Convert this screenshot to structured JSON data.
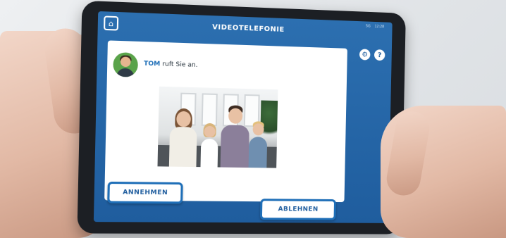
{
  "screen": {
    "title": "VIDEOTELEFONIE",
    "status_left": "5G",
    "status_right": "12:28",
    "accent_color": "#1f5d9e"
  },
  "icons": {
    "home": "home-icon",
    "settings": "gear-icon",
    "help": "question-icon"
  },
  "help_glyph": "?",
  "settings_glyph": "⚙",
  "home_glyph": "⌂",
  "call": {
    "caller_name": "TOM",
    "caller_text": " ruft Sie an."
  },
  "buttons": {
    "accept_label": "ANNEHMEN",
    "decline_label": "ABLEHNEN"
  }
}
